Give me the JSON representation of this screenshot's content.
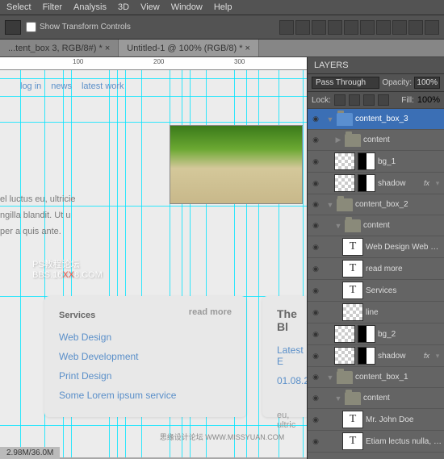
{
  "menu": [
    "Select",
    "Filter",
    "Analysis",
    "3D",
    "View",
    "Window",
    "Help"
  ],
  "toolbar": {
    "showTransform": "Show Transform Controls"
  },
  "tabs": [
    {
      "label": "...tent_box 3, RGB/8#) * ×"
    },
    {
      "label": "Untitled-1 @ 100% (RGB/8) * ×"
    }
  ],
  "ruler": {
    "n100": "100",
    "n200": "200",
    "n300": "300"
  },
  "nav": [
    "log in",
    "news",
    "latest work"
  ],
  "bodyText": [
    "el luctus eu, ultricie",
    "ngilla blandit. Ut u",
    "per a quis ante."
  ],
  "watermark": {
    "l1": "PS教程论坛",
    "l2a": "BBS.16",
    "l2b": "XX",
    "l2c": "8.COM"
  },
  "card1": {
    "title": "Services",
    "more": "read more",
    "links": [
      "Web Design",
      "Web Development",
      "Print Design",
      "Some Lorem ipsum service"
    ]
  },
  "card2": {
    "title": "The Bl",
    "sub": "Latest E",
    "date": "01.08.2",
    "meta": "eu, ultric"
  },
  "status": "2.98M/36.0M",
  "panels": {
    "tab": "LAYERS",
    "blend": "Pass Through",
    "opacityLbl": "Opacity:",
    "opacity": "100%",
    "lockLbl": "Lock:",
    "fillLbl": "Fill:",
    "fill": "100%"
  },
  "layers": [
    {
      "type": "folder",
      "name": "content_box_3",
      "sel": true,
      "ind": 0,
      "arrow": "▼"
    },
    {
      "type": "folder",
      "name": "content",
      "ind": 1,
      "arrow": "▶"
    },
    {
      "type": "mask",
      "name": "bg_1",
      "ind": 1
    },
    {
      "type": "mask",
      "name": "shadow",
      "ind": 1,
      "fx": true
    },
    {
      "type": "folder",
      "name": "content_box_2",
      "ind": 0,
      "arrow": "▼"
    },
    {
      "type": "folder",
      "name": "content",
      "ind": 1,
      "arrow": "▼"
    },
    {
      "type": "text",
      "name": "Web Design Web Dev...",
      "ind": 2
    },
    {
      "type": "text",
      "name": "read more",
      "ind": 2
    },
    {
      "type": "text",
      "name": "Services",
      "ind": 2
    },
    {
      "type": "layer",
      "name": "line",
      "ind": 2
    },
    {
      "type": "mask",
      "name": "bg_2",
      "ind": 1
    },
    {
      "type": "mask",
      "name": "shadow",
      "ind": 1,
      "fx": true
    },
    {
      "type": "folder",
      "name": "content_box_1",
      "ind": 0,
      "arrow": "▼"
    },
    {
      "type": "folder",
      "name": "content",
      "ind": 1,
      "arrow": "▼"
    },
    {
      "type": "text",
      "name": "Mr. John Doe",
      "ind": 2
    },
    {
      "type": "text",
      "name": "Etiam lectus nulla, ves...",
      "ind": 2
    }
  ],
  "footer": "思缘设计论坛  WWW.MISSYUAN.COM"
}
